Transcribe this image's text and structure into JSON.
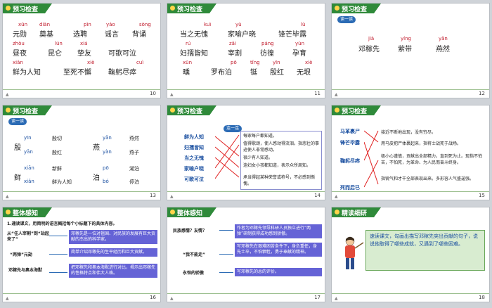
{
  "slides": {
    "s1": {
      "title": "预习检查",
      "number": "10",
      "rows": [
        {
          "py": [
            "xūn",
            "diàn",
            "pìn",
            "yáo",
            "sòng"
          ],
          "words": [
            "元勋",
            "奠基",
            "选聘",
            "谣言",
            "背诵"
          ]
        },
        {
          "py": [
            "zhòu",
            "lún",
            "xiá",
            "",
            ""
          ],
          "words": [
            "昼夜",
            "昆仑",
            "挚友",
            "可歌可泣"
          ]
        },
        {
          "py": [
            "xiǎn",
            "",
            "xiè",
            "",
            "cuì"
          ],
          "words": [
            "鲜为人知",
            "至死不懈",
            "鞠躬尽瘁"
          ]
        }
      ]
    },
    "s2": {
      "title": "预习检查",
      "number": "11",
      "rows": [
        {
          "py": [
            "kuì",
            "yù",
            "",
            "lù"
          ],
          "words": [
            "当之无愧",
            "家喻户晓",
            "锋芒毕露"
          ]
        },
        {
          "py": [
            "rú",
            "zǎi",
            "páng",
            "yùn"
          ],
          "words": [
            "妇孺皆知",
            "宰割",
            "彷徨",
            "孕育"
          ]
        },
        {
          "py": [
            "xūn",
            "",
            "pō",
            "tǐng",
            "yīn",
            "xiè"
          ],
          "words": [
            "曛",
            "罗布泊",
            "铤",
            "殷红",
            "无垠"
          ]
        }
      ]
    },
    "s3": {
      "title": "预习检查",
      "number": "12",
      "badge": "读一读",
      "py": [
        "jià",
        "yíng",
        "yān"
      ],
      "words": [
        "邓稼先",
        "萦带",
        "燕然"
      ]
    },
    "s4": {
      "title": "预习检查",
      "number": "13",
      "badge": "读一读",
      "groups": [
        {
          "char": "殷",
          "items": [
            {
              "py": "yīn",
              "ex": "殷切"
            },
            {
              "py": "yān",
              "ex": "殷红"
            }
          ]
        },
        {
          "char": "燕",
          "items": [
            {
              "py": "yān",
              "ex": "燕然"
            },
            {
              "py": "yàn",
              "ex": "燕子"
            }
          ]
        },
        {
          "char": "鲜",
          "items": [
            {
              "py": "xiān",
              "ex": "新鲜"
            },
            {
              "py": "xiǎn",
              "ex": "鲜为人知"
            }
          ]
        },
        {
          "char": "泊",
          "items": [
            {
              "py": "pō",
              "ex": "湖泊"
            },
            {
              "py": "bó",
              "ex": "停泊"
            }
          ]
        }
      ]
    },
    "s5": {
      "title": "预习检查",
      "number": "14",
      "badge": "连一连",
      "left": [
        "鲜为人知",
        "妇孺皆知",
        "当之无愧",
        "家喻户晓",
        "可歌可泣"
      ],
      "right": [
        "每家每户都知道。",
        "值得歌颂，使人感动得流泪。指悲壮的事迹使人非常感动。",
        "很少有人知道。",
        "连妇女小孩都知道，表示众所周知。",
        "承当得起某种荣誉或称号，不必感到惭愧。"
      ]
    },
    "s6": {
      "title": "预习检查",
      "number": "15",
      "left": [
        "马革裹尸",
        "锋芒毕露",
        "鞠躬尽瘁",
        "死而后已"
      ],
      "right": [
        "接近不断地出现，没有穷尽。",
        "用马皮把尸体裹起来，指将士战死于战场。",
        "极小心谨慎，贡献出全部精力，直到死为止。现指不怕苦，不怕死，为革命、为人民而奋斗终身。",
        "指锐气和才干全部表现出来。多形容人气盛逞强。"
      ]
    },
    "s7": {
      "title": "整体感知",
      "number": "16",
      "question": "1.通读课文，用简明的语言概括每个小标题下的具体内容。",
      "items": [
        {
          "label": "从“任人宰割”到“站起来了”",
          "desc": "邓稼先是一位对祖国、对民族的发展有巨大贡献的杰出的科学家。"
        },
        {
          "label": "“两弹”元勋",
          "desc": "简单介绍邓稼先的生平经历和巨大贡献。"
        },
        {
          "label": "邓稼先与奥本海默",
          "desc": "把邓稼先和奥本海默进行对比，揭示出邓稼先的性格特点和伟大人格。"
        }
      ]
    },
    "s8": {
      "title": "整体感知",
      "number": "17",
      "items": [
        {
          "label": "民族感情？友情？",
          "desc": "作者为邓稼先领导科研人员独立进行“两弹”研制获得成功感到骄傲。"
        },
        {
          "label": "“我不能走”",
          "desc": "写邓稼先在艰难困苦条件下，身负重任，身先士卒，不怕牺牲，勇于奉献的精神。"
        },
        {
          "label": "永恒的骄傲",
          "desc": "写邓稼先的总的评价。"
        }
      ]
    },
    "s9": {
      "title": "精读细研",
      "number": "18",
      "prompt": "速读课文，勾画出描写邓稼先突出贡献的句子，说说他取得了哪些成就，又遇到了哪些困难。"
    }
  }
}
